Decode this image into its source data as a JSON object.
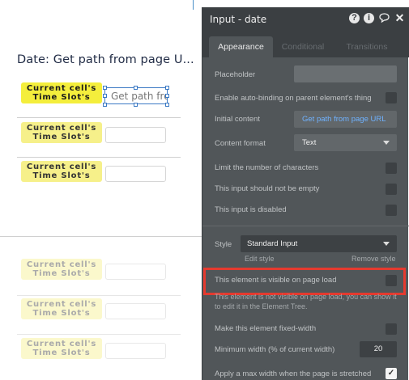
{
  "canvas": {
    "page_title": "Date: Get path from page U...",
    "cells": [
      {
        "line1": "Current cell's",
        "line2": "Time Slot's",
        "state": "active"
      },
      {
        "line1": "Current cell's",
        "line2": "Time Slot's",
        "state": "normal"
      },
      {
        "line1": "Current cell's",
        "line2": "Time Slot's",
        "state": "normal"
      },
      {
        "line1": "Current cell's",
        "line2": "Time Slot's",
        "state": "faded"
      },
      {
        "line1": "Current cell's",
        "line2": "Time Slot's",
        "state": "faded"
      },
      {
        "line1": "Current cell's",
        "line2": "Time Slot's",
        "state": "faded"
      }
    ],
    "selected_input_text": "Get path fro"
  },
  "panel": {
    "title": "Input - date",
    "icons": [
      "help-icon",
      "info-icon",
      "comment-icon",
      "close-icon"
    ],
    "tabs": [
      "Appearance",
      "Conditional",
      "Transitions"
    ],
    "active_tab": "Appearance",
    "placeholder_label": "Placeholder",
    "auto_binding_label": "Enable auto-binding on parent element's thing",
    "auto_binding_checked": false,
    "initial_content_label": "Initial content",
    "initial_content_value": "Get path from page URL",
    "content_format_label": "Content format",
    "content_format_value": "Text",
    "limit_chars_label": "Limit the number of characters",
    "not_empty_label": "This input should not be empty",
    "disabled_label": "This input is disabled",
    "style_label": "Style",
    "style_value": "Standard Input",
    "edit_style": "Edit style",
    "remove_style": "Remove style",
    "visible_label": "This element is visible on page load",
    "visible_checked": false,
    "visible_note": "This element is not visible on page load, you can show it to edit it in the Element Tree.",
    "fixed_width_label": "Make this element fixed-width",
    "min_width_label": "Minimum width (% of current width)",
    "min_width_value": "20",
    "max_width_label": "Apply a max width when the page is stretched",
    "max_width_checked": true
  },
  "colors": {
    "panel_bg": "#515659",
    "panel_header": "#3b3f42",
    "link_blue": "#6fb2ff",
    "highlight_red": "#e53a2f",
    "cell_yellow": "#f4ee3c"
  }
}
